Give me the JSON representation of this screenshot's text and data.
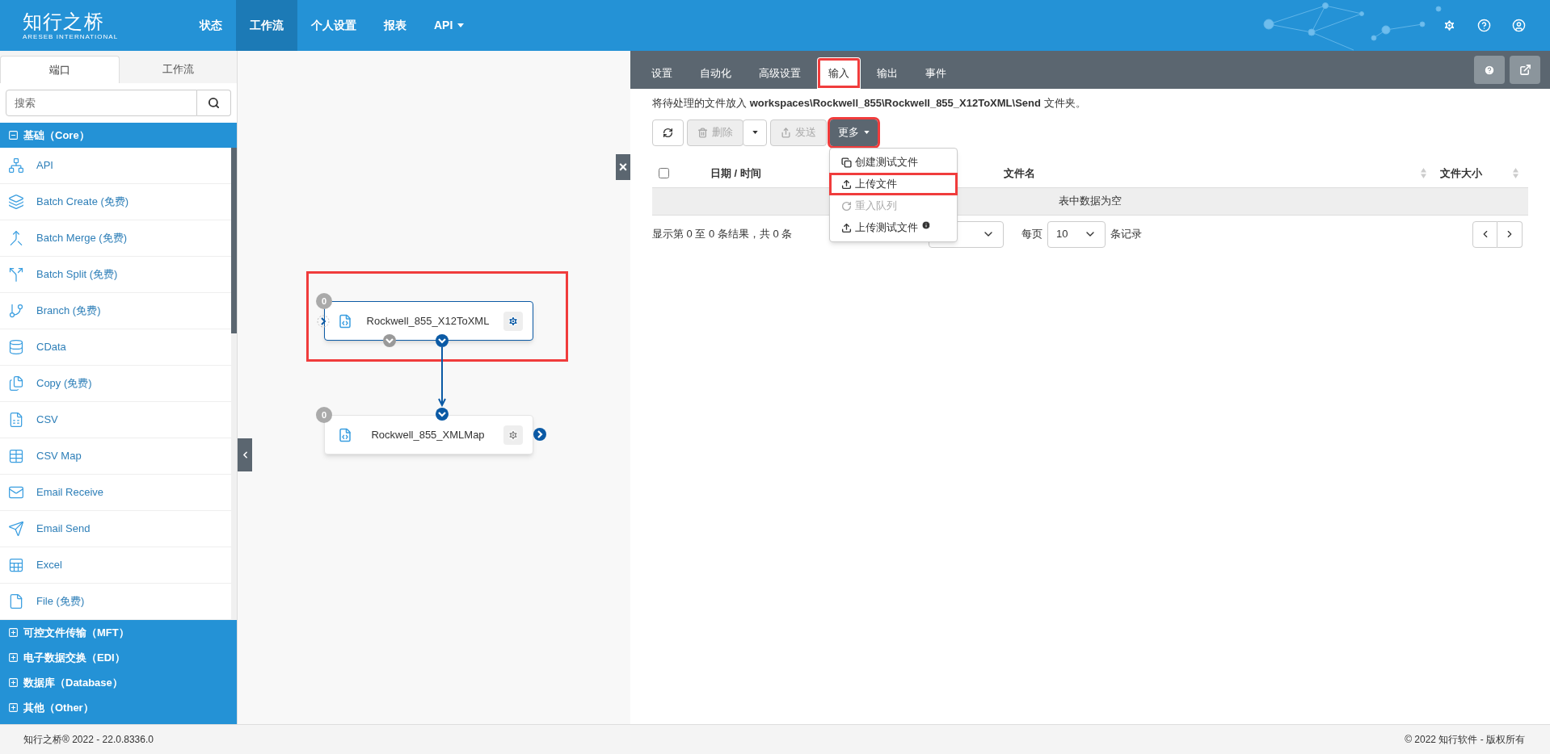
{
  "header": {
    "logo": {
      "title": "知行之桥",
      "subtitle": "ARESEB INTERNATIONAL"
    },
    "nav": [
      {
        "label": "状态",
        "selected": false,
        "dropdown": false
      },
      {
        "label": "工作流",
        "selected": true,
        "dropdown": false
      },
      {
        "label": "个人设置",
        "selected": false,
        "dropdown": false
      },
      {
        "label": "报表",
        "selected": false,
        "dropdown": false
      },
      {
        "label": "API",
        "selected": false,
        "dropdown": true
      }
    ]
  },
  "sidebar": {
    "tabs": [
      {
        "label": "端口",
        "selected": true
      },
      {
        "label": "工作流",
        "selected": false
      }
    ],
    "search": {
      "placeholder": "搜索"
    },
    "groups": [
      {
        "label": "基础（Core）",
        "expanded": true,
        "items": [
          "API",
          "Batch Create (免费)",
          "Batch Merge (免费)",
          "Batch Split (免费)",
          "Branch (免费)",
          "CData",
          "Copy (免费)",
          "CSV",
          "CSV Map",
          "Email Receive",
          "Email Send",
          "Excel",
          "File (免费)"
        ]
      },
      {
        "label": "可控文件传输（MFT）",
        "expanded": false
      },
      {
        "label": "电子数据交换（EDI）",
        "expanded": false
      },
      {
        "label": "数据库（Database）",
        "expanded": false
      },
      {
        "label": "其他（Other）",
        "expanded": false
      }
    ]
  },
  "canvas": {
    "nodes": [
      {
        "name": "Rockwell_855_X12ToXML",
        "count": "0",
        "selected": true,
        "highlighted": true
      },
      {
        "name": "Rockwell_855_XMLMap",
        "count": "0",
        "selected": false
      }
    ],
    "close_button": "×"
  },
  "panel": {
    "tabs": [
      {
        "label": "设置",
        "selected": false,
        "highlighted": false
      },
      {
        "label": "自动化",
        "selected": false,
        "highlighted": false
      },
      {
        "label": "高级设置",
        "selected": false,
        "highlighted": false
      },
      {
        "label": "输入",
        "selected": true,
        "highlighted": true
      },
      {
        "label": "输出",
        "selected": false,
        "highlighted": false
      },
      {
        "label": "事件",
        "selected": false,
        "highlighted": false
      }
    ],
    "info": "将待处理的文件放入 **workspaces\\Rockwell_855\\Rockwell_855_X12ToXML\\Send** 文件夹。",
    "toolbar": [
      {
        "kind": "refresh",
        "disabled": false,
        "highlighted": false
      },
      {
        "kind": "delete",
        "label": "删除",
        "disabled": true,
        "highlighted": false
      },
      {
        "kind": "send",
        "label": "发送",
        "disabled": true,
        "highlighted": false
      },
      {
        "kind": "more",
        "label": "更多",
        "disabled": false,
        "highlighted": true
      }
    ],
    "menu": [
      {
        "kind": "copy",
        "label": "创建测试文件",
        "disabled": false,
        "highlighted": false,
        "info": false
      },
      {
        "kind": "upload",
        "label": "上传文件",
        "disabled": false,
        "highlighted": true,
        "info": false
      },
      {
        "kind": "redo",
        "label": "重入队列",
        "disabled": true,
        "highlighted": false,
        "info": false
      },
      {
        "kind": "upload",
        "label": "上传测试文件",
        "disabled": false,
        "highlighted": false,
        "info": true
      }
    ],
    "table": {
      "columns": [
        "日期 / 时间",
        "文件名",
        "文件大小"
      ],
      "checked": false,
      "empty": "表中数据为空"
    },
    "pagination": {
      "summary": "显示第 0 至 0 条结果，共 0 条",
      "per_page_label": "每页",
      "per_page": "10",
      "records_label": "条记录"
    }
  },
  "footer": {
    "left": "知行之桥® 2022 - 22.0.8336.0",
    "right": "© 2022 知行软件 - 版权所有"
  }
}
